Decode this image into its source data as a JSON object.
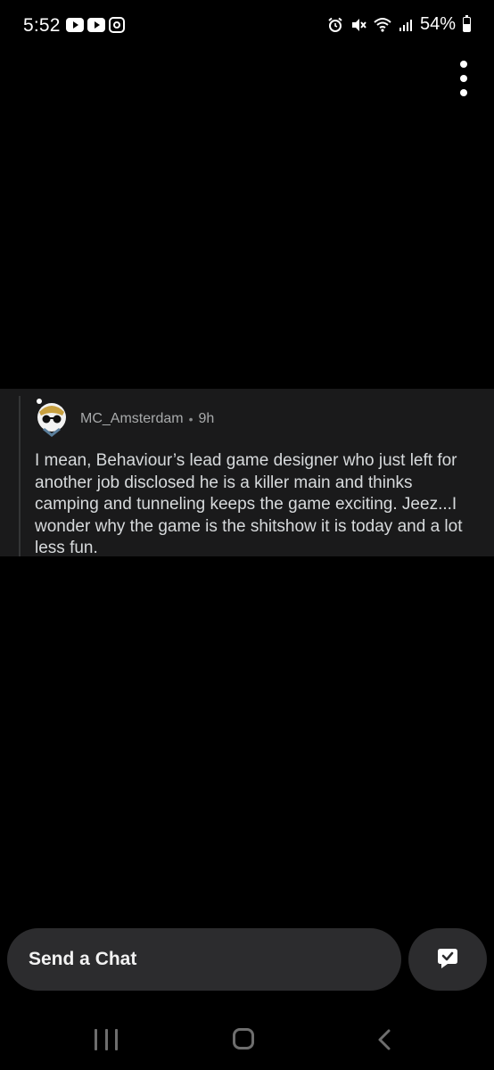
{
  "status_bar": {
    "time": "5:52",
    "battery": "54%"
  },
  "comment": {
    "username": "MC_Amsterdam",
    "separator": "•",
    "age": "9h",
    "body": "I mean, Behaviour’s lead game designer who just left for another job disclosed he is a killer main and thinks camping and tunneling keeps the game exciting. Jeez...I wonder why the game is the shitshow it is today and a lot less fun."
  },
  "chat": {
    "placeholder": "Send a Chat"
  },
  "colors": {
    "background": "#000000",
    "card": "#1a1a1b",
    "chat_pill": "#2c2c2e",
    "meta_text": "#a8aaab",
    "body_text": "#d7dadc"
  }
}
